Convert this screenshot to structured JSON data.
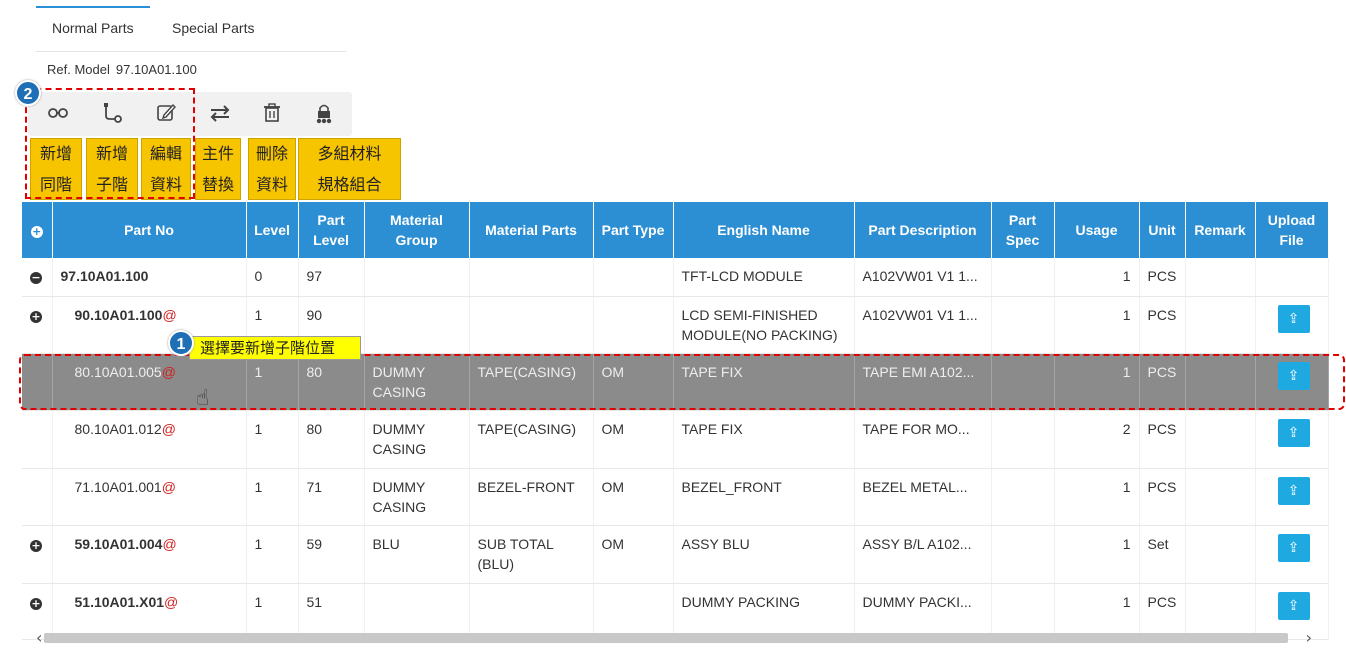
{
  "tabs": [
    {
      "label": "Normal Parts",
      "active": true
    },
    {
      "label": "Special Parts",
      "active": false
    }
  ],
  "ref_model": {
    "label": "Ref. Model",
    "value": "97.10A01.100"
  },
  "toolbar": {
    "icons": [
      "link-icon",
      "branch-icon",
      "edit-icon",
      "swap-icon",
      "trash-icon",
      "users-lock-icon"
    ],
    "labels": [
      {
        "line1": "新增",
        "line2": "同階"
      },
      {
        "line1": "新增",
        "line2": "子階"
      },
      {
        "line1": "編輯",
        "line2": "資料"
      },
      {
        "line1": "主件",
        "line2": "替換"
      },
      {
        "line1": "刪除",
        "line2": "資料"
      },
      {
        "line1": "多組材料",
        "line2": "規格組合"
      }
    ]
  },
  "callouts": {
    "badge1": "1",
    "badge2": "2",
    "tooltip": "選擇要新增子階位置"
  },
  "table": {
    "headers": [
      "Part No",
      "Level",
      "Part Level",
      "Material Group",
      "Material Parts",
      "Part Type",
      "English Name",
      "Part Description",
      "Part Spec",
      "Usage",
      "Unit",
      "Remark",
      "Upload File"
    ],
    "rows": [
      {
        "toggle": "−",
        "part_no": "97.10A01.100",
        "at": "",
        "level": "0",
        "part_level": "97",
        "material_group": "",
        "material_parts": "",
        "part_type": "",
        "english_name": "TFT-LCD MODULE",
        "part_description": "A102VW01 V1 1...",
        "part_spec": "",
        "usage": "1",
        "unit": "PCS",
        "remark": "",
        "upload": false
      },
      {
        "toggle": "+",
        "part_no": "90.10A01.100",
        "at": "@",
        "level": "1",
        "part_level": "90",
        "material_group": "",
        "material_parts": "",
        "part_type": "",
        "english_name": "LCD SEMI-FINISHED MODULE(NO PACKING)",
        "part_description": "A102VW01 V1 1...",
        "part_spec": "",
        "usage": "1",
        "unit": "PCS",
        "remark": "",
        "upload": true
      },
      {
        "toggle": "",
        "part_no": "80.10A01.005",
        "at": "@",
        "level": "1",
        "part_level": "80",
        "material_group": "DUMMY CASING",
        "material_parts": "TAPE(CASING)",
        "part_type": "OM",
        "english_name": "TAPE FIX",
        "part_description": "TAPE EMI A102...",
        "part_spec": "",
        "usage": "1",
        "unit": "PCS",
        "remark": "",
        "upload": true
      },
      {
        "toggle": "",
        "part_no": "80.10A01.012",
        "at": "@",
        "level": "1",
        "part_level": "80",
        "material_group": "DUMMY CASING",
        "material_parts": "TAPE(CASING)",
        "part_type": "OM",
        "english_name": "TAPE FIX",
        "part_description": "TAPE FOR MO...",
        "part_spec": "",
        "usage": "2",
        "unit": "PCS",
        "remark": "",
        "upload": true
      },
      {
        "toggle": "",
        "part_no": "71.10A01.001",
        "at": "@",
        "level": "1",
        "part_level": "71",
        "material_group": "DUMMY CASING",
        "material_parts": "BEZEL-FRONT",
        "part_type": "OM",
        "english_name": "BEZEL_FRONT",
        "part_description": "BEZEL METAL...",
        "part_spec": "",
        "usage": "1",
        "unit": "PCS",
        "remark": "",
        "upload": true
      },
      {
        "toggle": "+",
        "part_no": "59.10A01.004",
        "at": "@",
        "level": "1",
        "part_level": "59",
        "material_group": "BLU",
        "material_parts": "SUB TOTAL (BLU)",
        "part_type": "OM",
        "english_name": "ASSY BLU",
        "part_description": "ASSY B/L A102...",
        "part_spec": "",
        "usage": "1",
        "unit": "Set",
        "remark": "",
        "upload": true
      },
      {
        "toggle": "+",
        "part_no": "51.10A01.X01",
        "at": "@",
        "level": "1",
        "part_level": "51",
        "material_group": "",
        "material_parts": "",
        "part_type": "",
        "english_name": "DUMMY PACKING",
        "part_description": "DUMMY PACKI...",
        "part_spec": "",
        "usage": "1",
        "unit": "PCS",
        "remark": "",
        "upload": true
      }
    ],
    "selected_row": 2
  },
  "colors": {
    "header_bg": "#2d8fd3",
    "toolbar_label_bg": "#f7c400",
    "upload_btn": "#1fa9e1",
    "selected_row": "#8b8b8b",
    "highlight_border": "#e00000"
  }
}
